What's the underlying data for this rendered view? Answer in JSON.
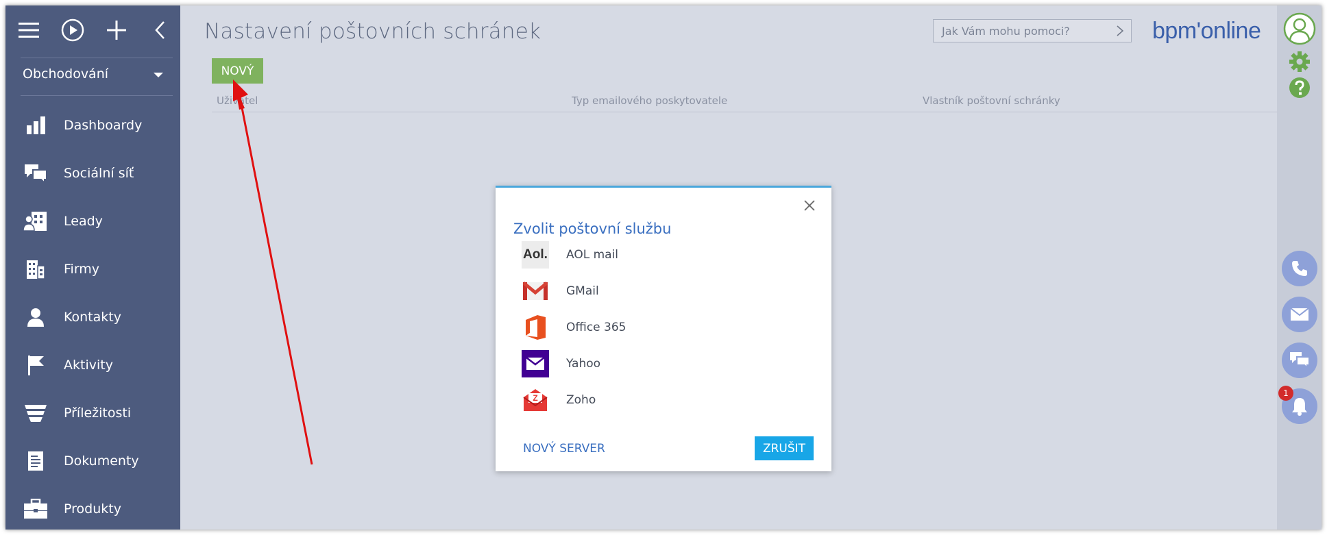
{
  "sidebar": {
    "workplace": "Obchodování",
    "items": [
      {
        "label": "Dashboardy",
        "icon": "dashboards-icon"
      },
      {
        "label": "Sociální síť",
        "icon": "social-network-icon"
      },
      {
        "label": "Leady",
        "icon": "leads-icon"
      },
      {
        "label": "Firmy",
        "icon": "accounts-icon"
      },
      {
        "label": "Kontakty",
        "icon": "contacts-icon"
      },
      {
        "label": "Aktivity",
        "icon": "activities-icon"
      },
      {
        "label": "Příležitosti",
        "icon": "opportunities-icon"
      },
      {
        "label": "Dokumenty",
        "icon": "documents-icon"
      },
      {
        "label": "Produkty",
        "icon": "products-icon"
      }
    ]
  },
  "header": {
    "title": "Nastavení poštovních schránek",
    "search_placeholder": "Jak Vám mohu pomoci?",
    "brand": "bpm'online"
  },
  "toolbar": {
    "new_label": "NOVÝ"
  },
  "grid": {
    "columns": [
      "Uživatel",
      "Typ emailového poskytovatele",
      "Vlastník poštovní schránky"
    ]
  },
  "right_panel": {
    "notification_count": "1"
  },
  "modal": {
    "title": "Zvolit poštovní službu",
    "services": [
      {
        "name": "AOL mail",
        "logo": "aol-logo",
        "logo_text": "Aol."
      },
      {
        "name": "GMail",
        "logo": "gmail-logo"
      },
      {
        "name": "Office 365",
        "logo": "office365-logo"
      },
      {
        "name": "Yahoo",
        "logo": "yahoo-logo"
      },
      {
        "name": "Zoho",
        "logo": "zoho-logo",
        "logo_text": "Z"
      }
    ],
    "new_server_label": "NOVÝ SERVER",
    "cancel_label": "ZRUŠIT"
  },
  "colors": {
    "sidebar_bg": "#4d5b7e",
    "main_bg": "#d6dae4",
    "new_button": "#7fb25e",
    "cancel_button": "#18a6e7",
    "link": "#3a6fc0",
    "gear": "#6aa84f",
    "annotation_arrow": "#e01010"
  }
}
